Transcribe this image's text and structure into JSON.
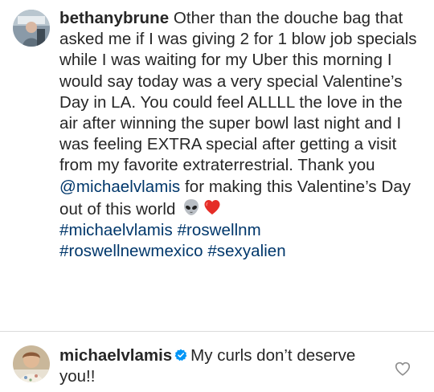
{
  "caption": {
    "username": "bethanybrune",
    "text_part1": " Other than the douche bag that asked me if I was giving 2 for 1 blow job specials while I was waiting for my Uber this morning I would say today was a very special Valentine’s Day in LA. You could feel ALLLL the love in the air after winning the super bowl last night and I was feeling EXTRA special after getting a visit from my favorite extraterrestrial. Thank you ",
    "mention": "@michaelvlamis",
    "text_part2": " for making this Valentine’s Day out of this world ",
    "emojis": [
      "alien-emoji",
      "red-heart-emoji"
    ],
    "hashtags": [
      "#michaelvlamis",
      "#roswellnm",
      "#roswellnewmexico",
      "#sexyalien"
    ]
  },
  "comment": {
    "username": "michaelvlamis",
    "verified": true,
    "text": "My curls don’t deserve you!!"
  },
  "colors": {
    "text": "#262626",
    "link": "#00376b",
    "verified": "#0095f6",
    "heart": "#e0245e",
    "divider": "#dbdbdb"
  },
  "icons": {
    "like": "heart-outline-icon",
    "verified": "verified-badge-icon"
  }
}
